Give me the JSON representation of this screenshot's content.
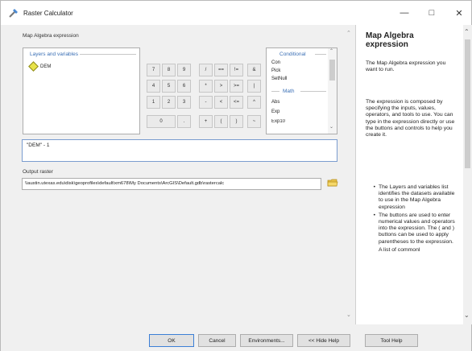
{
  "window": {
    "title": "Raster Calculator"
  },
  "main": {
    "expr_section_label": "Map Algebra expression",
    "layers": {
      "header": "Layers and variables",
      "items": [
        "DEM"
      ]
    },
    "keypad": [
      [
        "7",
        "8",
        "9",
        "/",
        "==",
        "!=",
        "&"
      ],
      [
        "4",
        "5",
        "6",
        "*",
        ">",
        ">=",
        "|"
      ],
      [
        "1",
        "2",
        "3",
        "-",
        "<",
        "<=",
        "^"
      ],
      [
        "0",
        ".",
        "+",
        "(",
        ")",
        "~"
      ]
    ],
    "functions": {
      "conditional_header": "Conditional",
      "conditional_items": [
        "Con",
        "Pick",
        "SetNull"
      ],
      "math_header": "Math",
      "math_items": [
        "Abs",
        "Exp",
        "Exp10"
      ]
    },
    "expression": "\"DEM\" - 1",
    "output_label": "Output raster",
    "output_value": "\\\\austin.utexas.edu\\disk\\geoprofiles\\default\\xm678\\My Documents\\ArcGIS\\Default.gdb\\rastercalc"
  },
  "help": {
    "title": "Map Algebra expression",
    "p1": "The Map Algebra expression you want to run.",
    "p2": "The expression is composed by specifying the inputs, values, operators, and tools to use. You can type in the expression directly or use the buttons and controls to help you create it.",
    "bullets": [
      "The Layers and variables list identifies the datasets available to use in the Map Algebra expression",
      "The buttons are used to enter numerical values and operators into the expression. The ( and ) buttons can be used to apply parentheses to the expression.",
      "A list of commonl"
    ]
  },
  "buttons": {
    "ok": "OK",
    "cancel": "Cancel",
    "environments": "Environments...",
    "hide_help": "<< Hide Help",
    "tool_help": "Tool Help"
  },
  "icons": {
    "app": "raster-calculator-icon",
    "minimize": "minimize-icon",
    "maximize": "maximize-icon",
    "close": "close-icon",
    "folder": "folder-icon",
    "layer": "raster-layer-icon"
  }
}
